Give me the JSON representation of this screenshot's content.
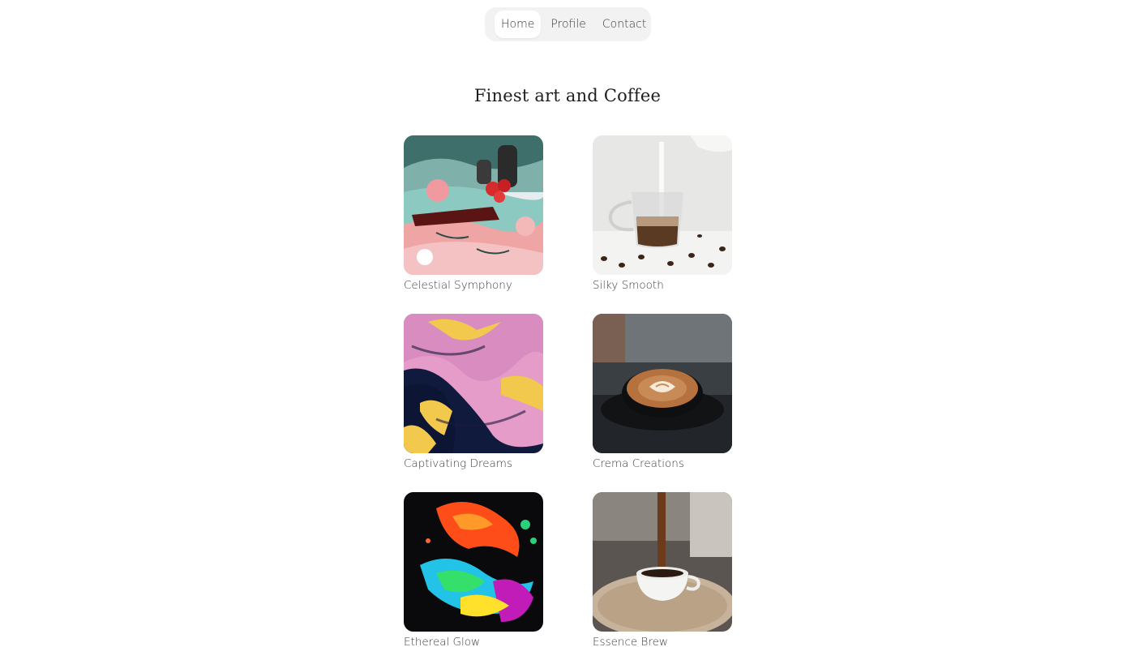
{
  "nav": {
    "items": [
      {
        "label": "Home",
        "active": true
      },
      {
        "label": "Profile",
        "active": false
      },
      {
        "label": "Contact",
        "active": false
      }
    ]
  },
  "page": {
    "title": "Finest art and Coffee"
  },
  "gallery": {
    "items": [
      {
        "caption": "Celestial Symphony",
        "image": "still-life-painting-pink-teal"
      },
      {
        "caption": "Silky Smooth",
        "image": "milk-pour-glass-coffee"
      },
      {
        "caption": "Captivating Dreams",
        "image": "pink-yellow-navy-marble-art"
      },
      {
        "caption": "Crema Creations",
        "image": "latte-art-cup"
      },
      {
        "caption": "Ethereal Glow",
        "image": "neon-fluid-art"
      },
      {
        "caption": "Essence Brew",
        "image": "espresso-pour-white-cup"
      }
    ]
  },
  "colors": {
    "nav_bg": "#f2f2f2",
    "nav_active_bg": "#ffffff",
    "text": "#333333"
  }
}
